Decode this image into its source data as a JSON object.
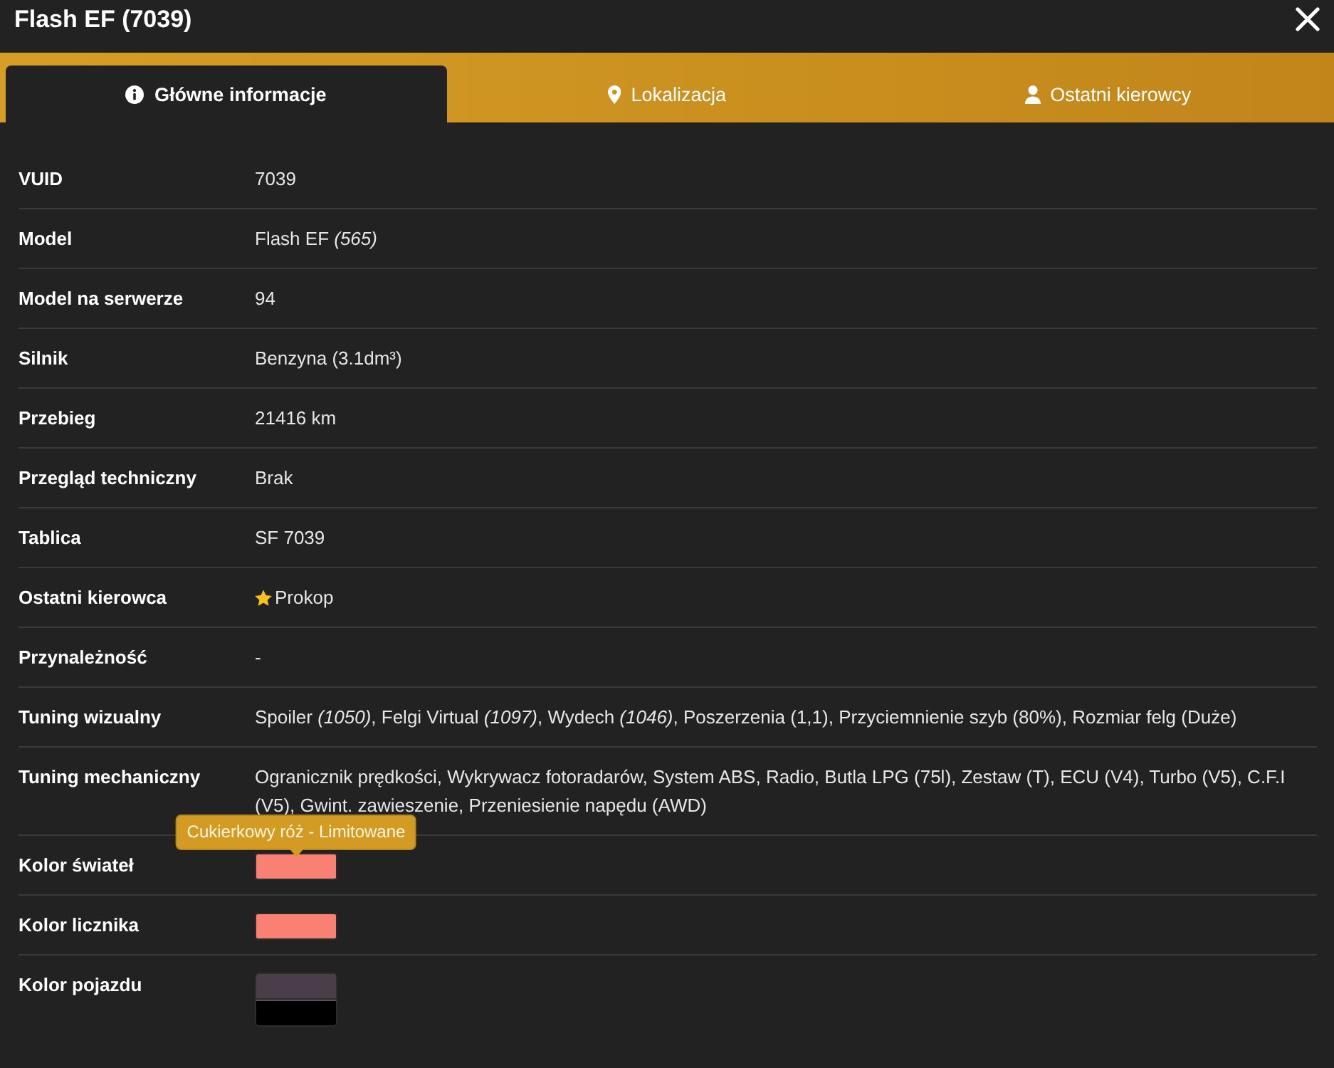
{
  "window": {
    "title": "Flash EF (7039)"
  },
  "tabs": [
    {
      "label": "Główne informacje",
      "selected": true
    },
    {
      "label": "Lokalizacja",
      "selected": false
    },
    {
      "label": "Ostatni kierowcy",
      "selected": false
    }
  ],
  "details": {
    "rows": [
      {
        "kind": "text",
        "label": "VUID",
        "value": "7039"
      },
      {
        "kind": "text",
        "label": "Model",
        "value": "Flash EF *(565)*"
      },
      {
        "kind": "text",
        "label": "Model na serwerze",
        "value": "94"
      },
      {
        "kind": "text",
        "label": "Silnik",
        "value": "Benzyna (3.1dm³)"
      },
      {
        "kind": "text",
        "label": "Przebieg",
        "value": "21416 km"
      },
      {
        "kind": "text",
        "label": "Przegląd techniczny",
        "value": "Brak"
      },
      {
        "kind": "text",
        "label": "Tablica",
        "value": "SF 7039"
      },
      {
        "kind": "text",
        "label": "Ostatni kierowca",
        "value": "Prokop",
        "starred": true
      },
      {
        "kind": "text",
        "label": "Przynależność",
        "value": "-"
      },
      {
        "kind": "text",
        "label": "Tuning wizualny",
        "value": "Spoiler *(1050)*, Felgi Virtual *(1097)*, Wydech *(1046)*, Poszerzenia (1,1), Przyciemnienie szyb (80%), Rozmiar felg (Duże)"
      },
      {
        "kind": "text",
        "label": "Tuning mechaniczny",
        "value": "Ogranicznik prędkości, Wykrywacz fotoradarów, System ABS, Radio, Butla LPG (75l), Zestaw (T), ECU (V4), Turbo (V5), C.F.I (V5), Gwint. zawieszenie, Przeniesienie napędu (AWD)"
      },
      {
        "kind": "colors",
        "label": "Kolor świateł",
        "swatches": [
          {
            "color": "#fa8072",
            "tooltip": "Cukierkowy róż - Limitowane"
          }
        ]
      },
      {
        "kind": "colors",
        "label": "Kolor licznika",
        "swatches": [
          {
            "color": "#fa8072"
          }
        ]
      },
      {
        "kind": "colors",
        "label": "Kolor pojazdu",
        "swatches": [
          {
            "color": "#4a3e4b"
          },
          {
            "color": "#000000"
          }
        ]
      }
    ]
  }
}
